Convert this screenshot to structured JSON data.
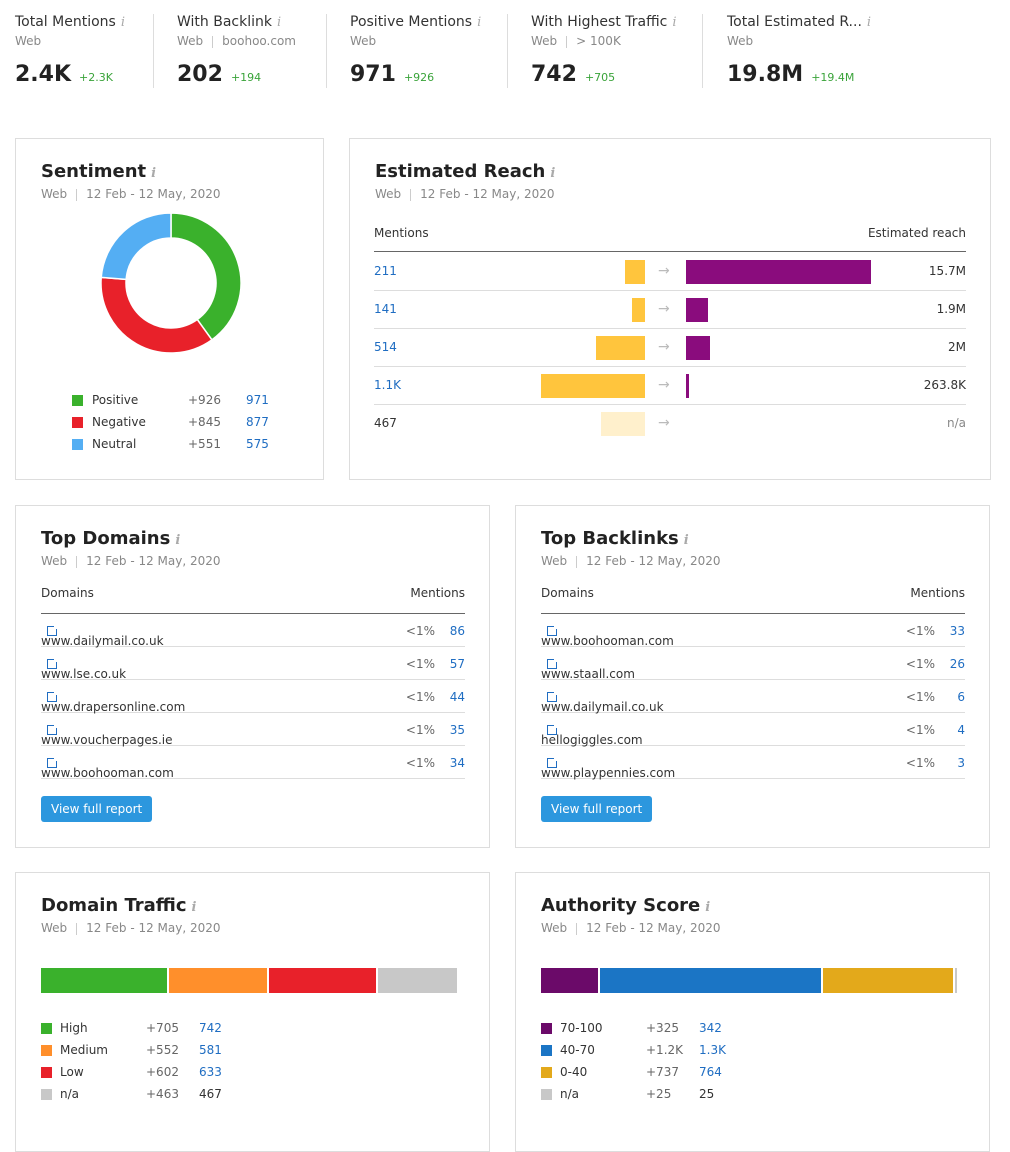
{
  "stats": [
    {
      "title": "Total Mentions",
      "sub": [
        "Web"
      ],
      "value": "2.4K",
      "delta": "+2.3K"
    },
    {
      "title": "With Backlink",
      "sub": [
        "Web",
        "boohoo.com"
      ],
      "value": "202",
      "delta": "+194"
    },
    {
      "title": "Positive Mentions",
      "sub": [
        "Web"
      ],
      "value": "971",
      "delta": "+926"
    },
    {
      "title": "With Highest Traffic",
      "sub": [
        "Web",
        "> 100K"
      ],
      "value": "742",
      "delta": "+705"
    },
    {
      "title": "Total Estimated R...",
      "sub": [
        "Web"
      ],
      "value": "19.8M",
      "delta": "+19.4M"
    }
  ],
  "info_icon": "i",
  "source": "Web",
  "date_range": "12 Feb - 12 May, 2020",
  "sentiment": {
    "title": "Sentiment",
    "items": [
      {
        "label": "Positive",
        "delta": "+926",
        "value": "971",
        "count": 971,
        "color": "#3ab12c"
      },
      {
        "label": "Negative",
        "delta": "+845",
        "value": "877",
        "count": 877,
        "color": "#e8212a"
      },
      {
        "label": "Neutral",
        "delta": "+551",
        "value": "575",
        "count": 575,
        "color": "#54aef3"
      }
    ]
  },
  "reach": {
    "title": "Estimated Reach",
    "col_mentions": "Mentions",
    "col_reach": "Estimated reach",
    "rows": [
      {
        "mentions": "211",
        "mentions_num": 211,
        "reach": "15.7M",
        "reach_num": 15700000,
        "link": true
      },
      {
        "mentions": "141",
        "mentions_num": 141,
        "reach": "1.9M",
        "reach_num": 1900000,
        "link": true
      },
      {
        "mentions": "514",
        "mentions_num": 514,
        "reach": "2M",
        "reach_num": 2000000,
        "link": true
      },
      {
        "mentions": "1.1K",
        "mentions_num": 1100,
        "reach": "263.8K",
        "reach_num": 263800,
        "link": true
      },
      {
        "mentions": "467",
        "mentions_num": 467,
        "reach": "n/a",
        "reach_num": null,
        "link": false
      }
    ],
    "colors": {
      "mentions": "#ffc53d",
      "mentions_na": "#fff0cc",
      "reach": "#8a0c7d"
    }
  },
  "top_domains": {
    "title": "Top Domains",
    "col_domain": "Domains",
    "col_mentions": "Mentions",
    "button": "View full report",
    "rows": [
      {
        "domain": "www.dailymail.co.uk",
        "pct": "<1%",
        "count": "86"
      },
      {
        "domain": "www.lse.co.uk",
        "pct": "<1%",
        "count": "57"
      },
      {
        "domain": "www.drapersonline.com",
        "pct": "<1%",
        "count": "44"
      },
      {
        "domain": "www.voucherpages.ie",
        "pct": "<1%",
        "count": "35"
      },
      {
        "domain": "www.boohooman.com",
        "pct": "<1%",
        "count": "34"
      }
    ]
  },
  "top_backlinks": {
    "title": "Top Backlinks",
    "col_domain": "Domains",
    "col_mentions": "Mentions",
    "button": "View full report",
    "rows": [
      {
        "domain": "www.boohooman.com",
        "pct": "<1%",
        "count": "33"
      },
      {
        "domain": "www.staall.com",
        "pct": "<1%",
        "count": "26"
      },
      {
        "domain": "www.dailymail.co.uk",
        "pct": "<1%",
        "count": "6"
      },
      {
        "domain": "hellogiggles.com",
        "pct": "<1%",
        "count": "4"
      },
      {
        "domain": "www.playpennies.com",
        "pct": "<1%",
        "count": "3"
      }
    ]
  },
  "domain_traffic": {
    "title": "Domain Traffic",
    "items": [
      {
        "label": "High",
        "delta": "+705",
        "value": "742",
        "count": 742,
        "color": "#3ab12c",
        "link": true
      },
      {
        "label": "Medium",
        "delta": "+552",
        "value": "581",
        "count": 581,
        "color": "#ff8f2b",
        "link": true
      },
      {
        "label": "Low",
        "delta": "+602",
        "value": "633",
        "count": 633,
        "color": "#e8212a",
        "link": true
      },
      {
        "label": "n/a",
        "delta": "+463",
        "value": "467",
        "count": 467,
        "color": "#c8c8c8",
        "link": false
      }
    ]
  },
  "authority": {
    "title": "Authority Score",
    "items": [
      {
        "label": "70-100",
        "delta": "+325",
        "value": "342",
        "count": 342,
        "color": "#6b0a69",
        "link": true
      },
      {
        "label": "40-70",
        "delta": "+1.2K",
        "value": "1.3K",
        "count": 1300,
        "color": "#1b75c5",
        "link": true
      },
      {
        "label": "0-40",
        "delta": "+737",
        "value": "764",
        "count": 764,
        "color": "#e3a91b",
        "link": true
      },
      {
        "label": "n/a",
        "delta": "+25",
        "value": "25",
        "count": 25,
        "color": "#c8c8c8",
        "link": false
      }
    ]
  }
}
